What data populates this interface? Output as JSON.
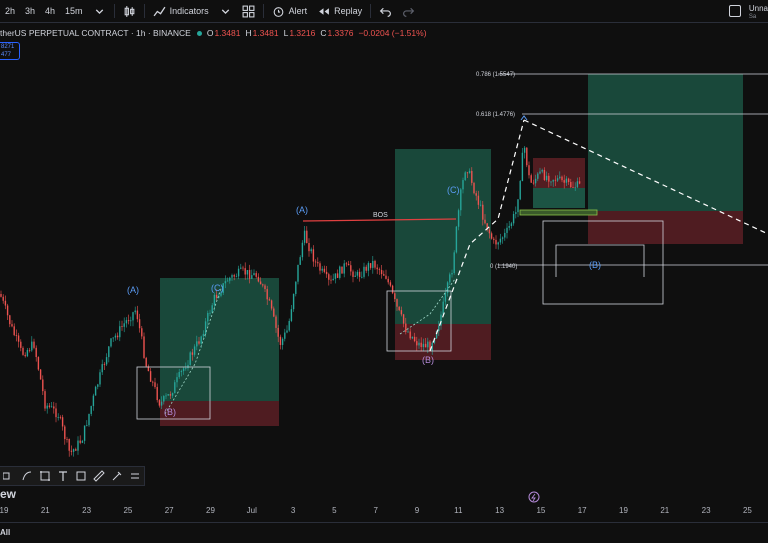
{
  "toolbar": {
    "intervals": [
      "2h",
      "3h",
      "4h",
      "15m"
    ],
    "indicators_label": "Indicators",
    "alert_label": "Alert",
    "replay_label": "Replay",
    "layout_name": "Unna",
    "layout_sub": "Sa"
  },
  "symbol": {
    "title": "therUS PERPETUAL CONTRACT · 1h · BINANCE",
    "ohlc": [
      {
        "label": "O",
        "value": "1.3481"
      },
      {
        "label": "H",
        "value": "1.3481"
      },
      {
        "label": "L",
        "value": "1.3216"
      },
      {
        "label": "C",
        "value": "1.3376"
      }
    ],
    "change": "−0.0204 (−1.51%)",
    "badge_top": "8271",
    "badge_bottom": "477"
  },
  "fib_labels": [
    {
      "text": "0.786 (1.5547)"
    },
    {
      "text": "0.618 (1.4776)"
    },
    {
      "text": "0 (1.1940)"
    }
  ],
  "wave_labels": [
    {
      "text": "(A)",
      "color": "#5b9cf5"
    },
    {
      "text": "(C)",
      "color": "#5b9cf5"
    },
    {
      "text": "(B)",
      "color": "#b48ad8"
    },
    {
      "text": "(A)",
      "color": "#5b9cf5"
    },
    {
      "text": "(C)",
      "color": "#5b9cf5"
    },
    {
      "text": "(B)",
      "color": "#b48ad8"
    },
    {
      "text": "(B)",
      "color": "#5b9cf5"
    }
  ],
  "bos_label": "BOS",
  "brand": "ew",
  "time_axis": [
    "19",
    "21",
    "23",
    "25",
    "27",
    "29",
    "Jul",
    "3",
    "5",
    "7",
    "9",
    "11",
    "13",
    "15",
    "17",
    "19",
    "21",
    "23",
    "25"
  ],
  "bottom": {
    "all_label": "All"
  },
  "colors": {
    "up": "#26a69a",
    "down": "#ef5350",
    "accent": "#2962ff",
    "bos": "#e04040",
    "zone_green": "#1e5c4a",
    "zone_red": "#5a1f24"
  }
}
